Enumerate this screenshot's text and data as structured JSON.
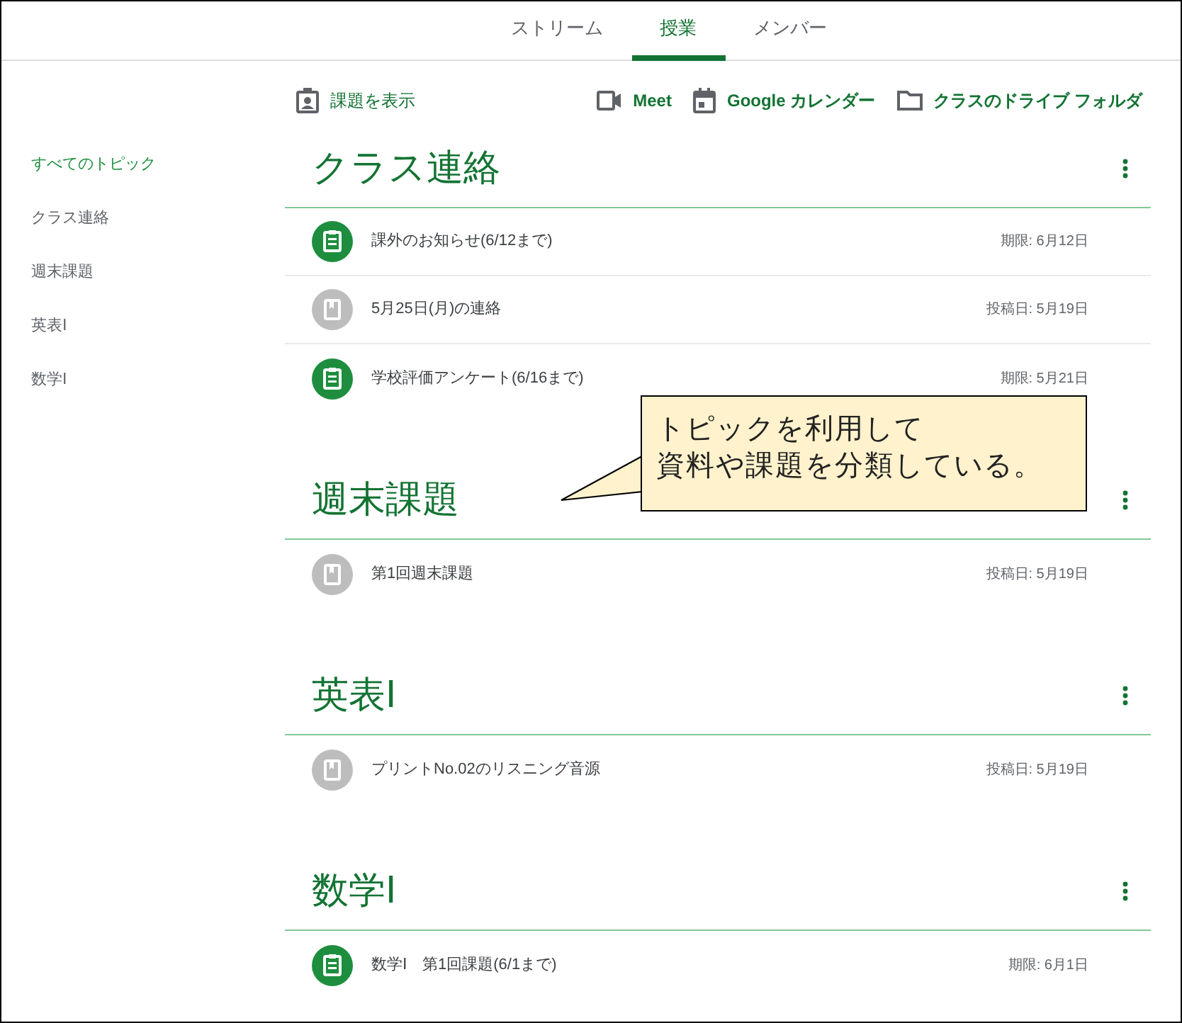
{
  "tabs": [
    {
      "label": "ストリーム",
      "selected": false
    },
    {
      "label": "授業",
      "selected": true
    },
    {
      "label": "メンバー",
      "selected": false
    }
  ],
  "toolbar": {
    "view_assignments": "課題を表示",
    "links": [
      {
        "kind": "meet",
        "label": "Meet"
      },
      {
        "kind": "calendar",
        "label": "Google カレンダー"
      },
      {
        "kind": "folder",
        "label": "クラスのドライブ フォルダ"
      }
    ]
  },
  "sidebar": {
    "items": [
      {
        "label": "すべてのトピック",
        "selected": true
      },
      {
        "label": "クラス連絡",
        "selected": false
      },
      {
        "label": "週末課題",
        "selected": false
      },
      {
        "label": "英表Ⅰ",
        "selected": false
      },
      {
        "label": "数学Ⅰ",
        "selected": false
      }
    ]
  },
  "topics": [
    {
      "title": "クラス連絡",
      "items": [
        {
          "kind": "assignment",
          "title": "課外のお知らせ(6/12まで)",
          "date": "期限: 6月12日"
        },
        {
          "kind": "material",
          "title": "5月25日(月)の連絡",
          "date": "投稿日: 5月19日"
        },
        {
          "kind": "assignment",
          "title": "学校評価アンケート(6/16まで)",
          "date": "期限: 5月21日"
        }
      ]
    },
    {
      "title": "週末課題",
      "items": [
        {
          "kind": "material",
          "title": "第1回週末課題",
          "date": "投稿日: 5月19日"
        }
      ]
    },
    {
      "title": "英表Ⅰ",
      "items": [
        {
          "kind": "material",
          "title": "プリントNo.02のリスニング音源",
          "date": "投稿日: 5月19日"
        }
      ]
    },
    {
      "title": "数学Ⅰ",
      "items": [
        {
          "kind": "assignment",
          "title": "数学Ⅰ　第1回課題(6/1まで)",
          "date": "期限: 6月1日"
        }
      ]
    }
  ],
  "callout": {
    "lines": [
      "トピックを利用して",
      "資料や課題を分類している。"
    ]
  }
}
